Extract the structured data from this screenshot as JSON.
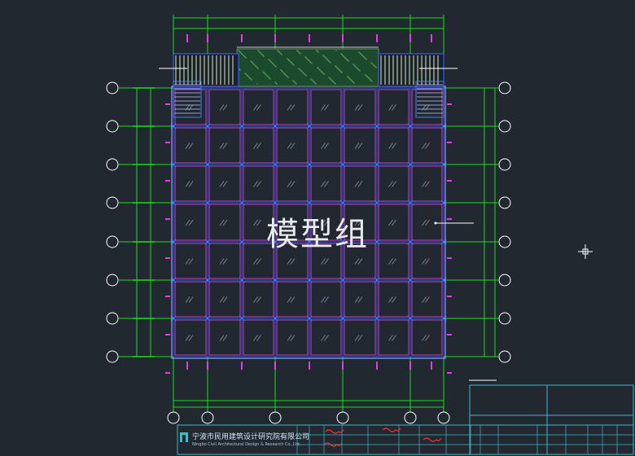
{
  "watermark": "模型组",
  "title_block": {
    "company_cn": "宁波市民用建筑设计研究院有限公司",
    "company_en": "Ningbo Civil Architectural Design & Research Co.,Ltd."
  },
  "colors": {
    "background": "#212830",
    "grid_axis": "#18e018",
    "glass_grid": "#c040c0",
    "mullion": "#2a4ad8",
    "axis_bubble": "#ffffff",
    "dimension": "#e040e0",
    "title_block": "#3fb8c8"
  },
  "icons": {
    "company_logo": "building-logo-icon",
    "cursor": "crosshair-icon"
  }
}
